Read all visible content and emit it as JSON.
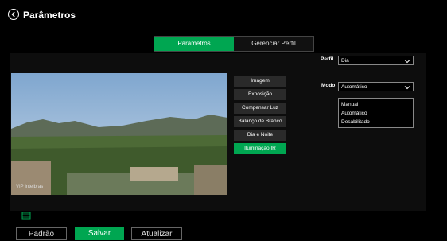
{
  "header": {
    "title": "Parâmetros",
    "back_icon": "back-circle-icon"
  },
  "tabs": [
    {
      "label": "Parâmetros",
      "active": true
    },
    {
      "label": "Gerenciar Perfil",
      "active": false
    }
  ],
  "video": {
    "watermark": "VIP Intelbras"
  },
  "menu": [
    {
      "label": "Imagem",
      "active": false
    },
    {
      "label": "Exposição",
      "active": false
    },
    {
      "label": "Compensar Luz",
      "active": false
    },
    {
      "label": "Balanço de Branco",
      "active": false
    },
    {
      "label": "Dia e Noite",
      "active": false
    },
    {
      "label": "Iluminação IR",
      "active": true
    }
  ],
  "profile": {
    "label": "Perfil",
    "value": "Dia"
  },
  "mode": {
    "label": "Modo",
    "value": "Automático",
    "options": [
      "Manual",
      "Automático",
      "Desabilitado"
    ]
  },
  "buttons": {
    "default": "Padrão",
    "save": "Salvar",
    "refresh": "Atualizar"
  },
  "colors": {
    "accent": "#00a651",
    "background": "#000000"
  }
}
